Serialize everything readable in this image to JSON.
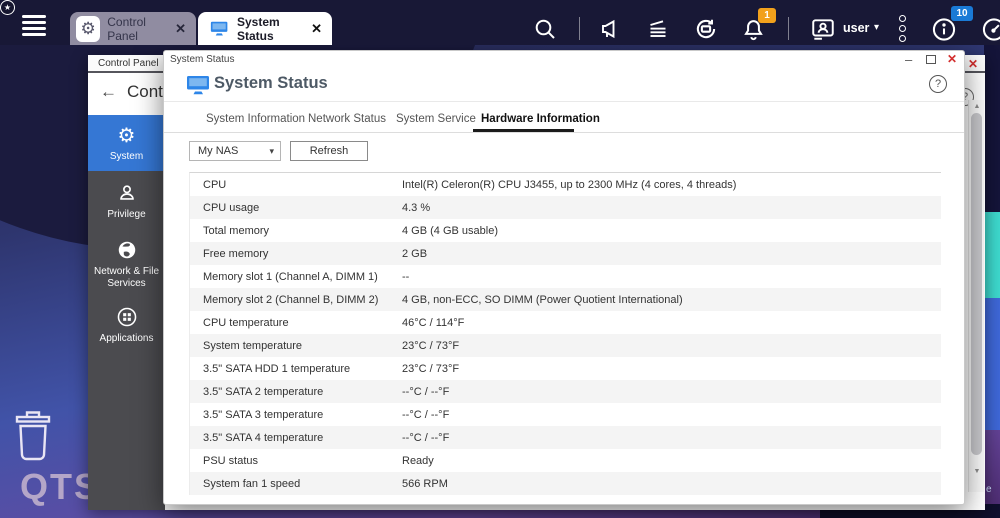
{
  "topbar": {
    "tabs": [
      {
        "label": "Control Panel",
        "icon": "gear"
      },
      {
        "label": "System Status",
        "icon": "monitor",
        "active": true
      }
    ],
    "user_label": "user",
    "notification_badge": "1",
    "info_badge": "10"
  },
  "desktop": {
    "logo": "QTS",
    "partial_icon_label": "e"
  },
  "control_panel": {
    "titlebar_label": "Control Panel",
    "heading": "Control Panel",
    "sidebar": {
      "items": [
        {
          "label": "System",
          "active": true
        },
        {
          "label": "Privilege",
          "active": false
        },
        {
          "label": "Network & File Services",
          "active": false
        },
        {
          "label": "Applications",
          "active": false
        }
      ]
    }
  },
  "system_status": {
    "titlebar_label": "System Status",
    "title": "System Status",
    "tabs": [
      {
        "label": "System Information",
        "active": false
      },
      {
        "label": "Network Status",
        "active": false
      },
      {
        "label": "System Service",
        "active": false
      },
      {
        "label": "Hardware Information",
        "active": true
      }
    ],
    "nas_select_value": "My NAS",
    "refresh_label": "Refresh",
    "hardware_table": {
      "rows": [
        {
          "label": "CPU",
          "value": "Intel(R) Celeron(R) CPU J3455, up to 2300 MHz (4 cores, 4 threads)"
        },
        {
          "label": "CPU usage",
          "value": "4.3 %"
        },
        {
          "label": "Total memory",
          "value": "4 GB (4 GB usable)"
        },
        {
          "label": "Free memory",
          "value": "2 GB"
        },
        {
          "label": "Memory slot 1 (Channel A, DIMM 1)",
          "value": "--"
        },
        {
          "label": "Memory slot 2 (Channel B, DIMM 2)",
          "value": "4 GB, non-ECC, SO DIMM (Power Quotient International)"
        },
        {
          "label": "CPU temperature",
          "value": "46°C / 114°F"
        },
        {
          "label": "System temperature",
          "value": "23°C / 73°F"
        },
        {
          "label": "3.5\" SATA HDD 1 temperature",
          "value": "23°C / 73°F"
        },
        {
          "label": "3.5\" SATA 2 temperature",
          "value": "--°C / --°F"
        },
        {
          "label": "3.5\" SATA 3 temperature",
          "value": "--°C / --°F"
        },
        {
          "label": "3.5\" SATA 4 temperature",
          "value": "--°C / --°F"
        },
        {
          "label": "PSU status",
          "value": "Ready"
        },
        {
          "label": "System fan 1 speed",
          "value": "566 RPM"
        }
      ]
    }
  },
  "glyphs": {
    "close": "✕",
    "minimize": "–",
    "caret_down": "▾",
    "star": "★",
    "back_arrow": "←",
    "question": "?",
    "gear": "⚙",
    "up_arrow": "▲",
    "down_arrow": "▼"
  },
  "colors": {
    "accent_blue": "#3577d4",
    "icon_blue": "#2e86e8",
    "notification_orange": "#f2a11c",
    "info_badge_blue": "#1a7ad6",
    "close_red": "#d32f2f",
    "topbar_navy": "#181836",
    "sidebar_gray": "#4b4b4f",
    "desktop_teal": "#3ed9ce"
  }
}
